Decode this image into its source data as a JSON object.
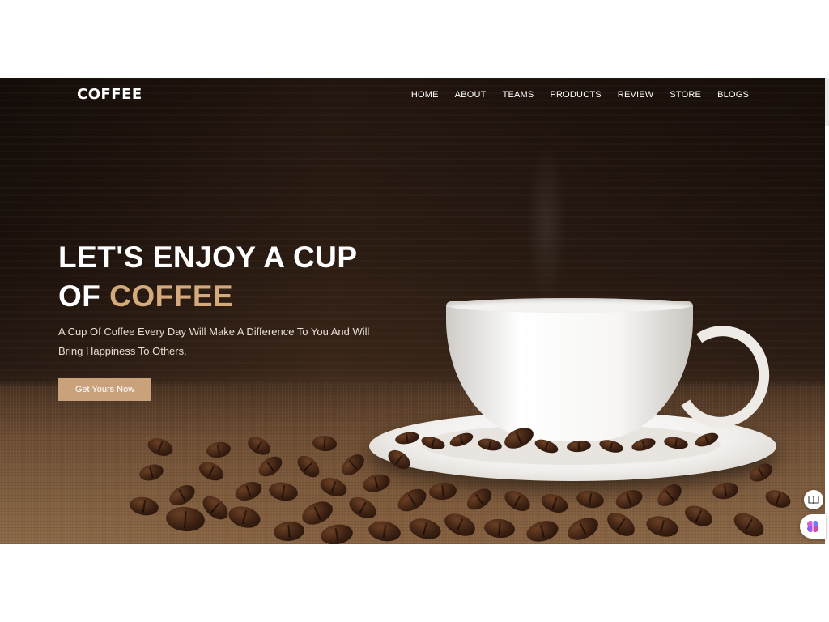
{
  "brand": {
    "logo": "COFFEE"
  },
  "nav": {
    "items": [
      {
        "label": "HOME"
      },
      {
        "label": "ABOUT"
      },
      {
        "label": "TEAMS"
      },
      {
        "label": "PRODUCTS"
      },
      {
        "label": "REVIEW"
      },
      {
        "label": "STORE"
      },
      {
        "label": "BLOGS"
      }
    ]
  },
  "hero": {
    "title_line1": "LET'S ENJOY A CUP",
    "title_line2_prefix": "OF ",
    "title_line2_accent": "COFFEE",
    "subtitle": "A Cup Of Coffee Every Day Will Make A Difference To You And Will Bring Happiness To Others.",
    "cta_label": "Get Yours Now"
  },
  "widgets": {
    "reader_icon": "book-icon",
    "assistant_icon": "brain-icon"
  },
  "colors": {
    "accent": "#d4a97c",
    "button": "#c9a27c",
    "text": "#ffffff"
  }
}
